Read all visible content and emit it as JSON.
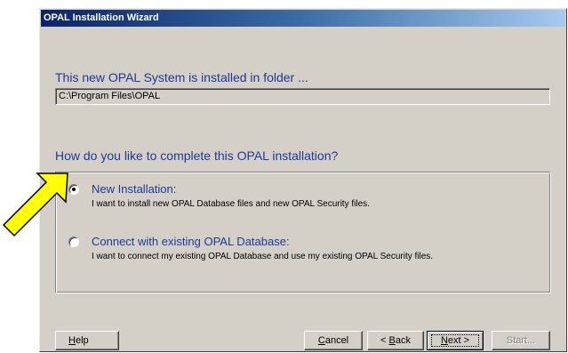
{
  "window": {
    "title": "OPAL Installation Wizard"
  },
  "folder": {
    "heading": "This new OPAL System is installed in folder ...",
    "path": "C:\\Program Files\\OPAL"
  },
  "question": "How do you like to complete this OPAL installation?",
  "options": [
    {
      "title": "New Installation:",
      "description": "I want to install new OPAL Database files and new OPAL Security files.",
      "selected": true
    },
    {
      "title": "Connect with existing OPAL Database:",
      "description": "I want to connect my existing OPAL Database and use my existing OPAL Security files.",
      "selected": false
    }
  ],
  "buttons": {
    "help": {
      "mnemonic": "H",
      "rest": "elp"
    },
    "cancel": {
      "mnemonic": "C",
      "rest": "ancel"
    },
    "back": {
      "prefix": "< ",
      "mnemonic": "B",
      "rest": "ack"
    },
    "next": {
      "mnemonic": "N",
      "rest": "ext >"
    },
    "start": "Start..."
  },
  "colors": {
    "heading_blue": "#1a3b9a",
    "title_bar": "#0a246a",
    "face": "#d4d0c8",
    "pointer_arrow": "#ffff00"
  },
  "icons": {
    "pointer": "yellow-arrow-pointer-icon"
  }
}
